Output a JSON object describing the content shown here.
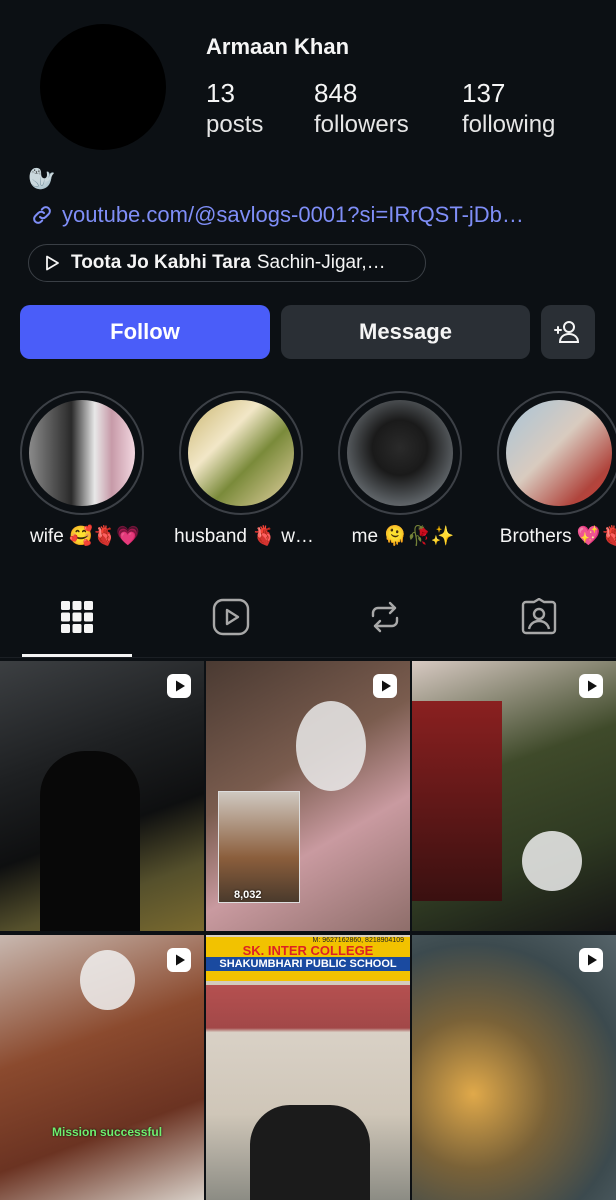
{
  "profile": {
    "name": "Armaan Khan",
    "stats": [
      {
        "value": "13",
        "label": "posts"
      },
      {
        "value": "848",
        "label": "followers"
      },
      {
        "value": "137",
        "label": "following"
      }
    ],
    "bio_emoji": "🦭",
    "link": "youtube.com/@savlogs-0001?si=IRrQST-jDb…",
    "music": {
      "title": "Toota Jo Kabhi Tara",
      "artist": "Sachin-Jigar,…"
    }
  },
  "actions": {
    "follow": "Follow",
    "message": "Message"
  },
  "highlights": [
    {
      "label": "wife 🥰🫀💗"
    },
    {
      "label": "husband 🫀 w…"
    },
    {
      "label": "me 🫠🥀✨"
    },
    {
      "label": "Brothers 💖🫀"
    }
  ],
  "tabs": [
    "grid",
    "reels",
    "reposts",
    "tagged"
  ],
  "grid": [
    {
      "type": "reel",
      "caption": ""
    },
    {
      "type": "reel",
      "caption": "8,032"
    },
    {
      "type": "reel",
      "caption": ""
    },
    {
      "type": "reel",
      "caption": "Mission successful"
    },
    {
      "type": "photo",
      "sign1": "SK. INTER COLLEGE",
      "sign2": "SHAKUMBHARI PUBLIC SCHOOL",
      "sign_top": "M: 9627162860, 8218904109"
    },
    {
      "type": "reel",
      "caption": ""
    }
  ],
  "colors": {
    "background": "#0c1014",
    "follow": "#4a5df9",
    "secondary": "#2a2f35",
    "link": "#7f8ef7"
  }
}
